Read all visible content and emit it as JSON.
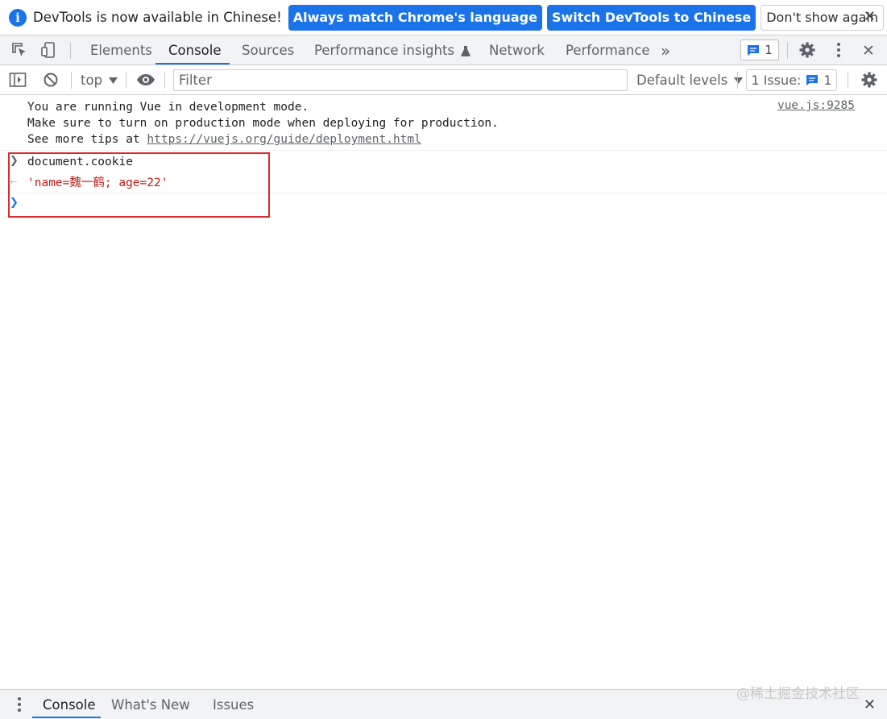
{
  "infobar": {
    "info_glyph": "i",
    "message": "DevTools is now available in Chinese!",
    "btn_match": "Always match Chrome's language",
    "btn_switch": "Switch DevTools to Chinese",
    "btn_dismiss": "Don't show again",
    "close_glyph": "✕"
  },
  "tabs": [
    {
      "label": "Elements",
      "active": false
    },
    {
      "label": "Console",
      "active": true
    },
    {
      "label": "Sources",
      "active": false
    },
    {
      "label": "Performance insights",
      "active": false
    },
    {
      "label": "Network",
      "active": false
    },
    {
      "label": "Performance",
      "active": false
    }
  ],
  "tabbar": {
    "more_glyph": "»",
    "message_count": "1",
    "close_glyph": "✕"
  },
  "console_toolbar": {
    "context": "top",
    "filter_placeholder": "Filter",
    "levels": "Default levels",
    "issues_label": "1 Issue:",
    "issues_count": "1"
  },
  "console": {
    "log_lines": [
      "You are running Vue in development mode.",
      "Make sure to turn on production mode when deploying for production.",
      "See more tips at "
    ],
    "log_link": "https://vuejs.org/guide/deployment.html",
    "log_source": "vue.js:9285",
    "command": "document.cookie",
    "result": "'name=魏一鹤; age=22'"
  },
  "drawer": {
    "tabs": [
      "Console",
      "What's New",
      "Issues"
    ],
    "close_glyph": "✕"
  },
  "watermark": "@稀土掘金技术社区",
  "colors": {
    "accent": "#1a73e8",
    "highlight_box": "#d92b2b",
    "string_value": "#c41a16"
  }
}
